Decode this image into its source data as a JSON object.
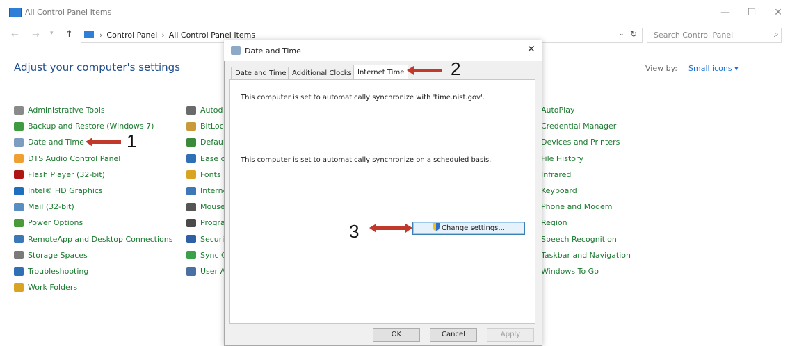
{
  "window": {
    "title": "All Control Panel Items",
    "minimize": "—",
    "maximize": "☐",
    "close": "✕"
  },
  "address_bar": {
    "crumbs": [
      "Control Panel",
      "All Control Panel Items"
    ],
    "separator": "›",
    "search_placeholder": "Search Control Panel"
  },
  "header": {
    "title": "Adjust your computer's settings",
    "view_by_label": "View by:",
    "view_by_value": "Small icons ▾"
  },
  "column1": [
    {
      "label": "Administrative Tools",
      "color": "#8a8a8a"
    },
    {
      "label": "Backup and Restore (Windows 7)",
      "color": "#3f9b3f"
    },
    {
      "label": "Date and Time",
      "color": "#7c9cc0"
    },
    {
      "label": "DTS Audio Control Panel",
      "color": "#f0a030"
    },
    {
      "label": "Flash Player (32-bit)",
      "color": "#b01515"
    },
    {
      "label": "Intel® HD Graphics",
      "color": "#1f6fc0"
    },
    {
      "label": "Mail (32-bit)",
      "color": "#5a8ec0"
    },
    {
      "label": "Power Options",
      "color": "#4a9a3a"
    },
    {
      "label": "RemoteApp and Desktop Connections",
      "color": "#3c78b8"
    },
    {
      "label": "Storage Spaces",
      "color": "#7a7a7a"
    },
    {
      "label": "Troubleshooting",
      "color": "#2f6fb5"
    },
    {
      "label": "Work Folders",
      "color": "#d9a421"
    }
  ],
  "column2": [
    {
      "label": "Autod",
      "color": "#6a6a6a"
    },
    {
      "label": "BitLoc",
      "color": "#c89a3a"
    },
    {
      "label": "Defaul",
      "color": "#3a8a3a"
    },
    {
      "label": "Ease of",
      "color": "#2f6fb5"
    },
    {
      "label": "Fonts",
      "color": "#d9a421"
    },
    {
      "label": "Interne",
      "color": "#3c78b8"
    },
    {
      "label": "Mouse",
      "color": "#555555"
    },
    {
      "label": "Progra",
      "color": "#4a4a4a"
    },
    {
      "label": "Securit",
      "color": "#2f5fa5"
    },
    {
      "label": "Sync C",
      "color": "#3aa04a"
    },
    {
      "label": "User A",
      "color": "#4a6fa5"
    }
  ],
  "column3": [
    {
      "label": "AutoPlay"
    },
    {
      "label": "Credential Manager"
    },
    {
      "label": "Devices and Printers"
    },
    {
      "label": "File History"
    },
    {
      "label": "Infrared"
    },
    {
      "label": "Keyboard"
    },
    {
      "label": "Phone and Modem"
    },
    {
      "label": "Region"
    },
    {
      "label": "Speech Recognition"
    },
    {
      "label": "Taskbar and Navigation"
    },
    {
      "label": "Windows To Go"
    }
  ],
  "dialog": {
    "title": "Date and Time",
    "close": "✕",
    "tabs": [
      "Date and Time",
      "Additional Clocks",
      "Internet Time"
    ],
    "active_tab": "Internet Time",
    "line1": "This computer is set to automatically synchronize with 'time.nist.gov'.",
    "line2": "This computer is set to automatically synchronize on a scheduled basis.",
    "change_button": "Change settings...",
    "ok": "OK",
    "cancel": "Cancel",
    "apply": "Apply"
  },
  "annotations": {
    "step1": "1",
    "step2": "2",
    "step3": "3",
    "arrow_color": "#c0392b"
  }
}
